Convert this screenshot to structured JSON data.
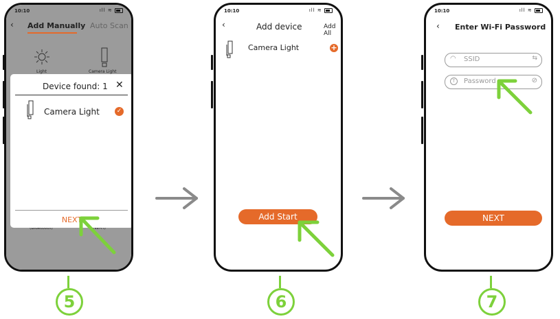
{
  "colors": {
    "accent": "#e56a2a",
    "highlight": "#7dd13b",
    "overlay": "#9b9b9b"
  },
  "screen5": {
    "time": "10:10",
    "tab_manual": "Add Manually",
    "tab_auto": "Auto Scan",
    "cat_light": "Light",
    "cat_camera": "Camera Light",
    "bottom_left": "(Bluetooth)",
    "bottom_right": "(Wi-Fi)",
    "dialog_title": "Device found: 1",
    "device_name": "Camera Light",
    "next_label": "NEXT",
    "step": "5"
  },
  "screen6": {
    "time": "10:10",
    "title": "Add device",
    "add_all": "Add All",
    "device_name": "Camera Light",
    "start_label": "Add Start",
    "step": "6"
  },
  "screen7": {
    "time": "10:10",
    "title": "Enter Wi-Fi Password",
    "ssid_placeholder": "SSID",
    "password_placeholder": "Password",
    "next_label": "NEXT",
    "step": "7"
  }
}
